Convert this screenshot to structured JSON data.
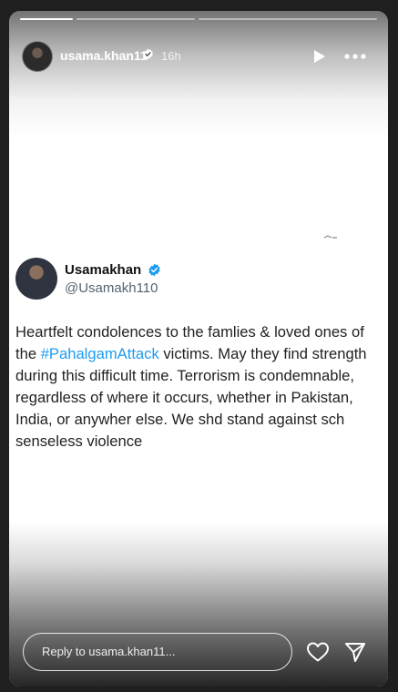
{
  "story": {
    "username": "usama.khan11",
    "time": "16h",
    "segments": 3,
    "active_segment": 1
  },
  "tweet": {
    "name": "Usamakhan",
    "handle": "@Usamakh110",
    "text_before": "Heartfelt condolences to the famlies & loved ones of the ",
    "hashtag": "#PahalgamAttack",
    "text_after": " victims. May they find strength during this difficult time. Terrorism is condemnable, regardless of where it occurs, whether in Pakistan, India, or anywher else. We shd stand against sch senseless violence"
  },
  "reply": {
    "placeholder": "Reply to usama.khan11..."
  },
  "colors": {
    "verified_blue": "#1d9bf0",
    "hashtag": "#1d9bf0"
  }
}
